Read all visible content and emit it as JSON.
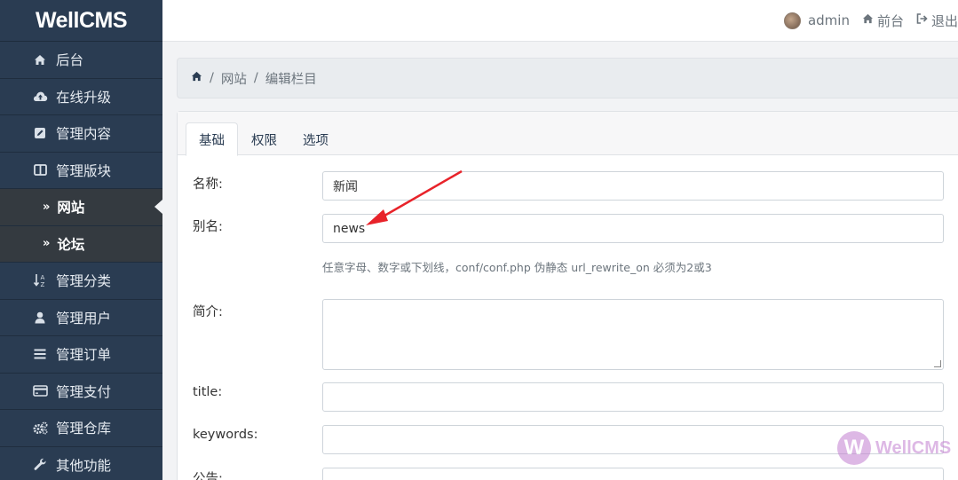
{
  "brand": "WellCMS",
  "topbar": {
    "user": "admin",
    "front_label": "前台",
    "logout_label": "退出"
  },
  "sidebar": {
    "items": [
      {
        "label": "后台",
        "icon": "home-icon"
      },
      {
        "label": "在线升级",
        "icon": "cloud-upload-icon"
      },
      {
        "label": "管理内容",
        "icon": "edit-icon"
      },
      {
        "label": "管理版块",
        "icon": "columns-icon"
      },
      {
        "label": "网站",
        "icon": "double-chevron-right-icon"
      },
      {
        "label": "论坛",
        "icon": "double-chevron-right-icon"
      },
      {
        "label": "管理分类",
        "icon": "sort-alpha-icon"
      },
      {
        "label": "管理用户",
        "icon": "user-icon"
      },
      {
        "label": "管理订单",
        "icon": "bars-icon"
      },
      {
        "label": "管理支付",
        "icon": "credit-card-icon"
      },
      {
        "label": "管理仓库",
        "icon": "cogs-icon"
      },
      {
        "label": "其他功能",
        "icon": "wrench-icon"
      }
    ]
  },
  "breadcrumb": {
    "level1": "网站",
    "level2": "编辑栏目"
  },
  "tabs": [
    "基础",
    "权限",
    "选项"
  ],
  "form": {
    "name_label": "名称:",
    "name_value": "新闻",
    "alias_label": "别名:",
    "alias_value": "news",
    "alias_hint": "任意字母、数字或下划线，conf/conf.php 伪静态 url_rewrite_on 必须为2或3",
    "intro_label": "简介:",
    "title_label": "title:",
    "keywords_label": "keywords:",
    "notice_label": "公告:"
  },
  "watermark": "WellCMS",
  "colors": {
    "sidebar_bg": "#2a3c52",
    "sub_bg": "#343a40",
    "annotation_arrow": "#e8232a",
    "watermark": "#c37fd0"
  }
}
